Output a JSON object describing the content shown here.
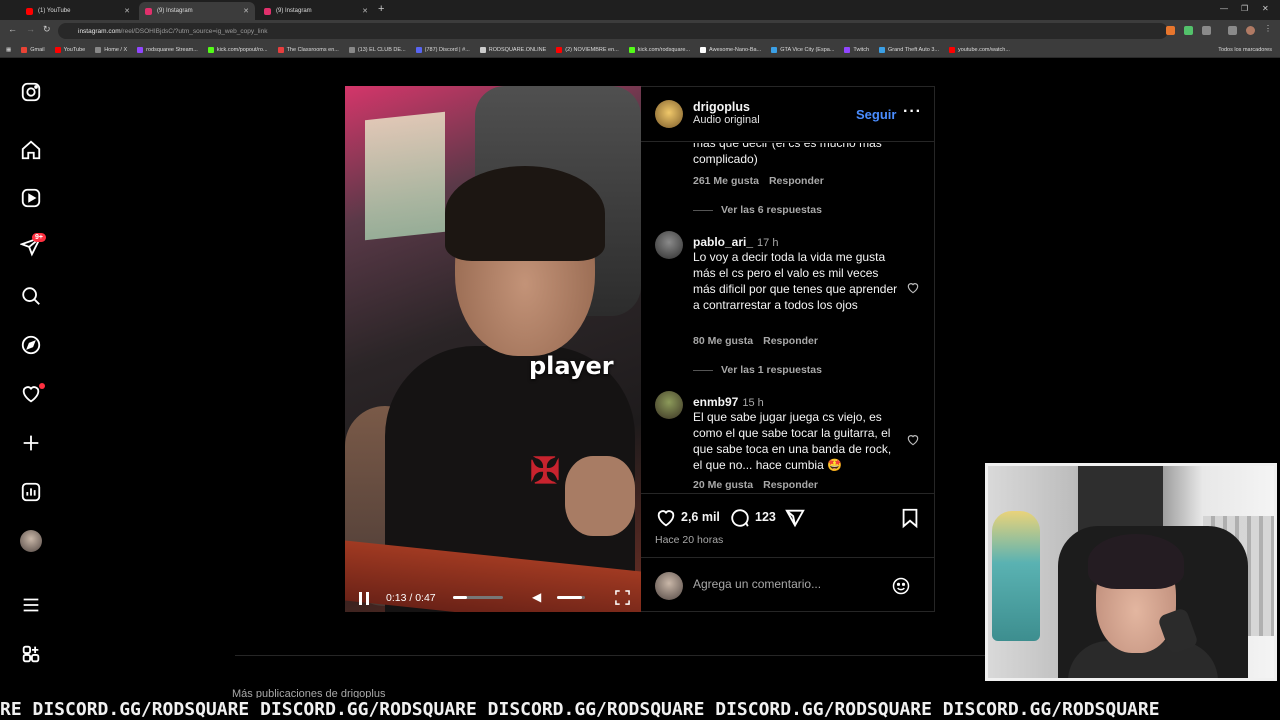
{
  "browser": {
    "tabs": [
      {
        "title": "(1) YouTube",
        "active": false,
        "color": "#ff0000"
      },
      {
        "title": "(9) Instagram",
        "active": true,
        "color": "#e1306c"
      },
      {
        "title": "(9) Instagram",
        "active": false,
        "color": "#e1306c"
      }
    ],
    "url_host": "instagram.com",
    "url_rest": "/reel/DSOHIBjdsC/?utm_source=ig_web_copy_link",
    "bookmarks": [
      {
        "label": "Gmail",
        "color": "#ea4335"
      },
      {
        "label": "YouTube",
        "color": "#ff0000"
      },
      {
        "label": "Home / X",
        "color": "#888888"
      },
      {
        "label": "rodsquaree Stream...",
        "color": "#9146ff"
      },
      {
        "label": "kick.com/popout/ro...",
        "color": "#53fc18"
      },
      {
        "label": "The Classrooms en...",
        "color": "#e83e3e"
      },
      {
        "label": "(13) EL CLUB DE...",
        "color": "#888888"
      },
      {
        "label": "(787) Discord | #...",
        "color": "#5865f2"
      },
      {
        "label": "RODSQUARE.ONLINE",
        "color": "#cccccc"
      },
      {
        "label": "(2) NOVIEMBRE en...",
        "color": "#ff0000"
      },
      {
        "label": "kick.com/rodsquare...",
        "color": "#53fc18"
      },
      {
        "label": "Awesome-Nano-Ba...",
        "color": "#ffffff"
      },
      {
        "label": "GTA Vice City (Espa...",
        "color": "#3ba0e6"
      },
      {
        "label": "Twitch",
        "color": "#9146ff"
      },
      {
        "label": "Grand Theft Auto 3...",
        "color": "#3ba0e6"
      },
      {
        "label": "youtube.com/watch...",
        "color": "#ff0000"
      }
    ],
    "all_bookmarks": "Todos los marcadores"
  },
  "sidebar": {
    "badge": "9+",
    "icons": [
      "instagram-logo-icon",
      "home-icon",
      "reels-icon",
      "messages-icon",
      "search-icon",
      "explore-icon",
      "notifications-icon",
      "create-icon",
      "dashboard-icon",
      "profile-avatar",
      "menu-icon",
      "more-apps-icon"
    ]
  },
  "reel": {
    "caption": "player",
    "current_time": "0:13",
    "duration": "0:47",
    "time_display": "0:13 / 0:47",
    "progress": 0.28,
    "volume": 0.9
  },
  "post": {
    "username": "drigoplus",
    "audio": "Audio original",
    "follow_label": "Seguir",
    "more_label": "···",
    "comments": [
      {
        "partial_text": "mas que decir (el cs es mucho mas complicado)",
        "likes": "261 Me gusta",
        "reply": "Responder",
        "view_replies": "Ver las 6 respuestas"
      },
      {
        "user": "pablo_ari_",
        "time": "17 h",
        "text": "Lo voy a decir toda la vida me gusta más el cs pero el valo es mil veces más dificil por que tenes que aprender a contrarrestar a todos los ojos",
        "likes": "80 Me gusta",
        "reply": "Responder",
        "view_replies": "Ver las 1 respuestas"
      },
      {
        "user": "enmb97",
        "time": "15 h",
        "text": "El que sabe jugar juega cs viejo, es como el que sabe tocar la guitarra, el que sabe toca en una banda de rock, el que no... hace cumbia 🤩",
        "likes": "20 Me gusta",
        "reply": "Responder"
      }
    ],
    "like_count": "2,6 mil",
    "comment_count": "123",
    "posted_ago": "Hace 20 horas",
    "add_comment_placeholder": "Agrega un comentario..."
  },
  "page_footer": {
    "more_from": "Más publicaciones de drigoplus"
  },
  "ticker": {
    "text": "RE DISCORD.GG/RODSQUARE DISCORD.GG/RODSQUARE DISCORD.GG/RODSQUARE DISCORD.GG/RODSQUARE DISCORD.GG/RODSQUARE"
  },
  "colors": {
    "accent_blue": "#4a8dff",
    "notification_red": "#ff3040"
  }
}
